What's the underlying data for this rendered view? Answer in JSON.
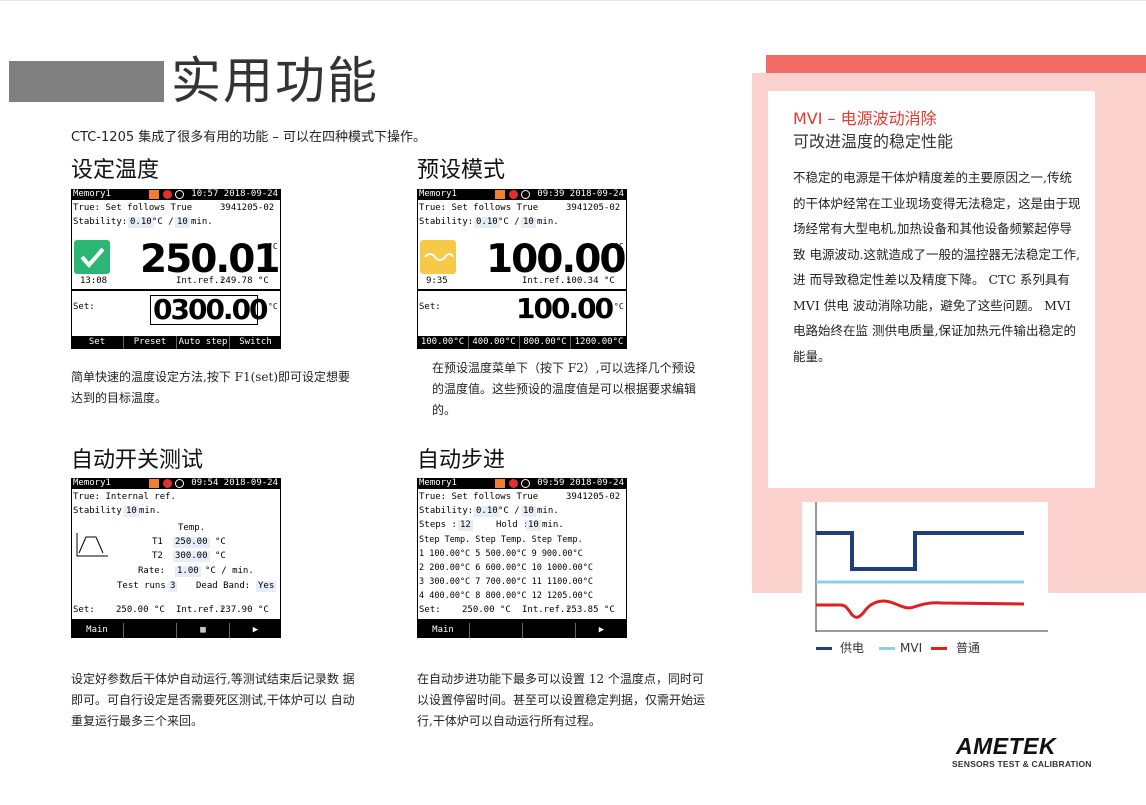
{
  "page": {
    "title": "实用功能",
    "intro": "CTC-1205 集成了很多有用的功能 – 可以在四种模式下操作。"
  },
  "sections": {
    "set_temp": {
      "title": "设定温度",
      "desc_l1": "简单快速的温度设定方法,按下 F1(set)即可设定想要",
      "desc_l2": "达到的目标温度。"
    },
    "preset": {
      "title": "预设模式",
      "desc_l1": "在预设温度菜单下（按下 F2）,可以选择几个预设",
      "desc_l2": "的温度值。这些预设的温度值是可以根据要求编辑",
      "desc_l3": "的。"
    },
    "auto_switch": {
      "title": "自动开关测试",
      "desc_l1": "设定好参数后干体炉自动运行,等测试结束后记录数 据",
      "desc_l2": "即可。可自行设定是否需要死区测试,干体炉可以 自动",
      "desc_l3": "重复运行最多三个来回。"
    },
    "auto_step": {
      "title": "自动步进",
      "desc_l1": "在自动步进功能下最多可以设置 12 个温度点，同时可",
      "desc_l2": "以设置停留时间。甚至可以设置稳定判据，仅需开始运",
      "desc_l3": "行,干体炉可以自动运行所有过程。"
    }
  },
  "screens": {
    "s1": {
      "memory": "Memory1",
      "time": "10:57  2018-09-24",
      "true_line": "True: Set follows True",
      "serial": "3941205-02",
      "stab_label": "Stability:",
      "stab_value": "0.10",
      "stab_unit": "°C /",
      "stab_min": "10",
      "stab_min_unit": "min.",
      "reading": "250.01",
      "unit": "°C",
      "clock": "13:08",
      "intref_label": "Int.ref.:",
      "intref_value": "249.78 °C",
      "set_label": "Set:",
      "set_value": "0300.00",
      "set_unit": "°C",
      "fkeys": [
        "Set",
        "Preset",
        "Auto step",
        "Switch"
      ]
    },
    "s2": {
      "memory": "Memory1",
      "time": "09:39  2018-09-24",
      "true_line": "True: Set follows True",
      "serial": "3941205-02",
      "stab_label": "Stability:",
      "stab_value": "0.10",
      "stab_unit": "°C /",
      "stab_min": "10",
      "stab_min_unit": "min.",
      "reading": "100.00",
      "unit": "°C",
      "clock": "9:35",
      "intref_label": "Int.ref.:",
      "intref_value": "100.34 °C",
      "set_label": "Set:",
      "set_value": "100.00",
      "set_unit": "°C",
      "fkeys": [
        "100.00°C",
        "400.00°C",
        "800.00°C",
        "1200.00°C"
      ]
    },
    "s3": {
      "memory": "Memory1",
      "time": "09:54  2018-09-24",
      "true_line": "True: Internal ref.",
      "stab_label": "Stability:",
      "stab_min": "10",
      "stab_min_unit": "min.",
      "temp_header": "Temp.",
      "t1_label": "T1",
      "t1_value": "250.00",
      "t1_unit": "°C",
      "t2_label": "T2",
      "t2_value": "300.00",
      "t2_unit": "°C",
      "rate_label": "Rate:",
      "rate_value": "1.00",
      "rate_unit": "°C / min.",
      "runs_label": "Test runs:",
      "runs_value": "3",
      "band_label": "Dead Band:",
      "band_value": "Yes",
      "set_line_label": "Set:",
      "set_line_value": "250.00 °C",
      "intref_label": "Int.ref.:",
      "intref_value": "237.90 °C",
      "fkeys": [
        "Main",
        "",
        "▦",
        "▶"
      ]
    },
    "s4": {
      "memory": "Memory1",
      "time": "09:59  2018-09-24",
      "true_line": "True: Set follows True",
      "serial": "3941205-02",
      "stab_label": "Stability:",
      "stab_value": "0.10",
      "stab_unit": "°C /",
      "stab_min": "10",
      "stab_min_unit": "min.",
      "steps_label": "Steps :",
      "steps_value": "12",
      "hold_label": "Hold :",
      "hold_value": "10",
      "hold_unit": "min.",
      "col_header": "Step  Temp.   Step  Temp.   Step  Temp.",
      "rows": [
        "  1   100.00°C  5   500.00°C  9    900.00°C",
        "  2   200.00°C  6   600.00°C 10  1000.00°C",
        "  3   300.00°C  7   700.00°C 11  1100.00°C",
        "  4   400.00°C  8   800.00°C 12  1205.00°C"
      ],
      "set_line_label": "Set:",
      "set_line_value": "250.00 °C",
      "intref_label": "Int.ref.:",
      "intref_value": "253.85 °C",
      "fkeys": [
        "Main",
        "",
        "",
        "▶"
      ]
    }
  },
  "mvi": {
    "title": "MVI – 电源波动消除",
    "subtitle": "可改进温度的稳定性能",
    "body": "不稳定的电源是干体炉精度差的主要原因之一,传统 的干体炉经常在工业现场变得无法稳定，这是由于现 场经常有大型电机,加热设备和其他设备频繁起停导致 电源波动.这就造成了一般的温控器无法稳定工作,进 而导致稳定性差以及精度下降。 CTC 系列具有 MVI 供电 波动消除功能，避免了这些问题。 MVI 电路始终在监 测供电质量,保证加热元件输出稳定的能量。"
  },
  "chart_data": {
    "type": "line",
    "title": "",
    "series": [
      {
        "name": "供电",
        "color": "#1f3f7a"
      },
      {
        "name": "MVI",
        "color": "#8fcfe8"
      },
      {
        "name": "普通",
        "color": "#e02020"
      }
    ],
    "grid": false,
    "legend": "bottom"
  },
  "logo": {
    "name": "AMETEK",
    "tagline": "SENSORS TEST & CALIBRATION"
  },
  "colors": {
    "accent_red": "#e23a30",
    "panel_salmon": "#fbd2cd",
    "panel_top": "#f36b65",
    "ok_green": "#2bb673",
    "wait_yellow": "#f7c948"
  }
}
